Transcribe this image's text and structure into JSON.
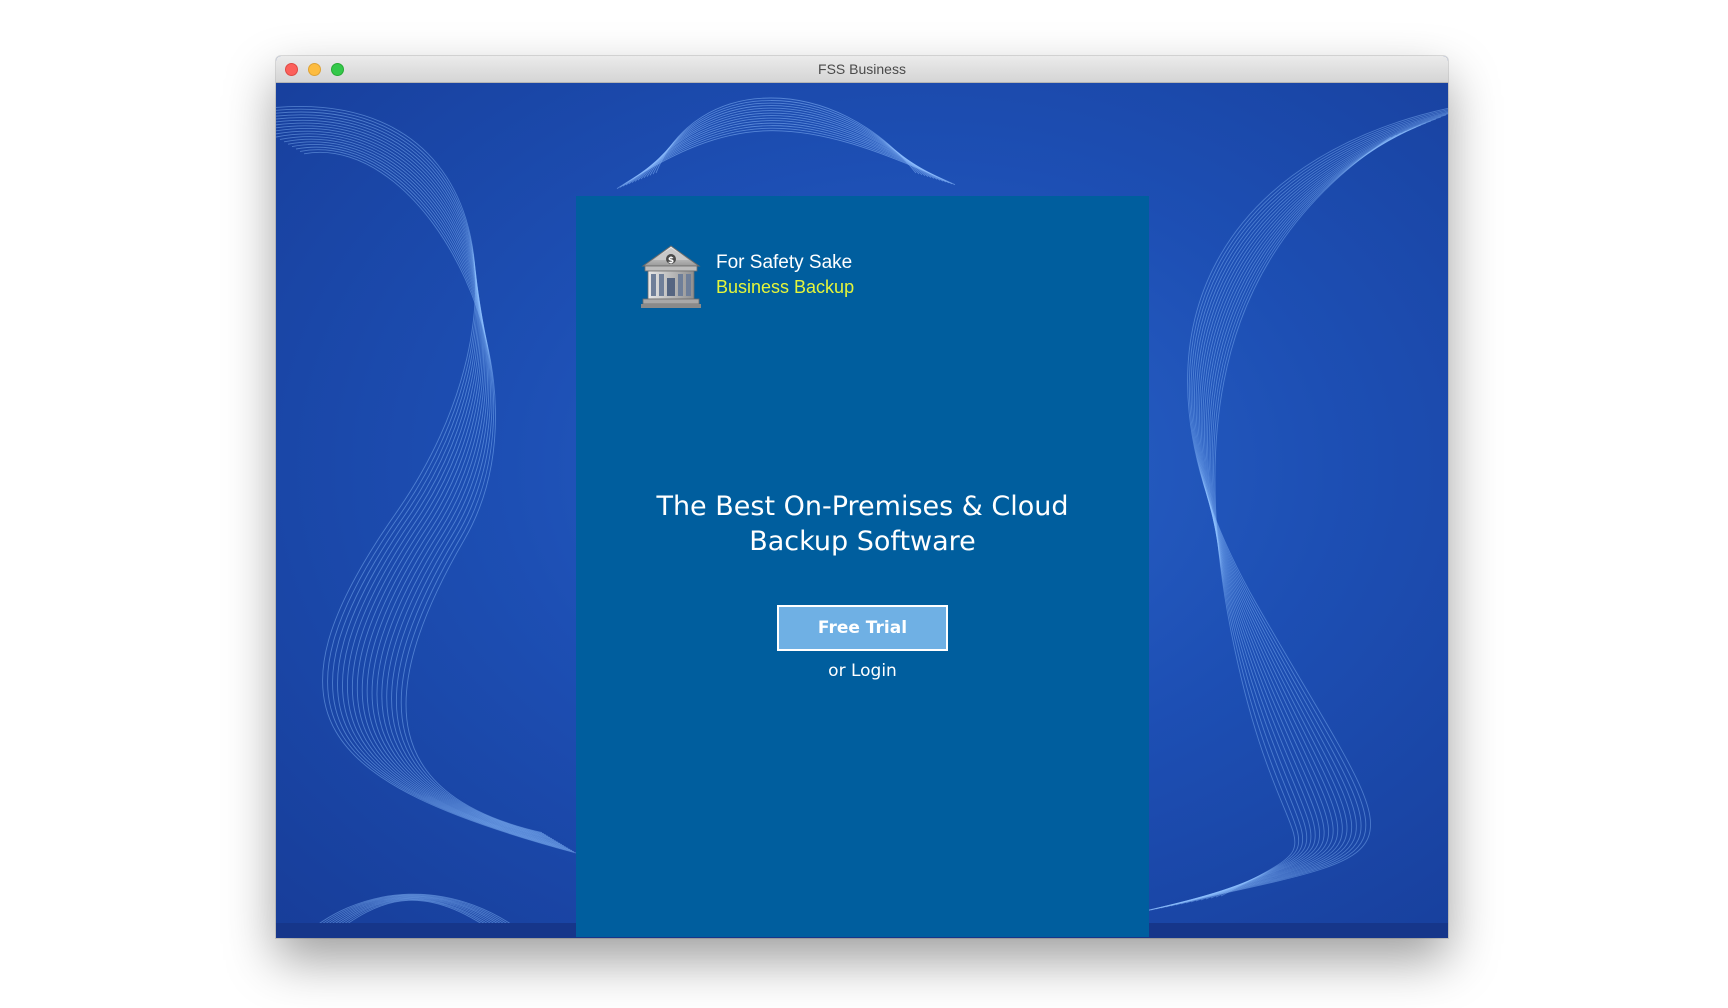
{
  "window": {
    "title": "FSS Business"
  },
  "logo": {
    "icon": "bank-building-icon",
    "line1": "For Safety Sake",
    "line2": "Business Backup"
  },
  "headline": {
    "line1": "The Best On-Premises & Cloud",
    "line2": "Backup Software"
  },
  "actions": {
    "trial_label": "Free Trial",
    "login_label": "or Login"
  },
  "colors": {
    "panel": "#005e9e",
    "background": "#1d4fb4",
    "button": "#6fb0e4",
    "tagline": "#e5f53a"
  }
}
